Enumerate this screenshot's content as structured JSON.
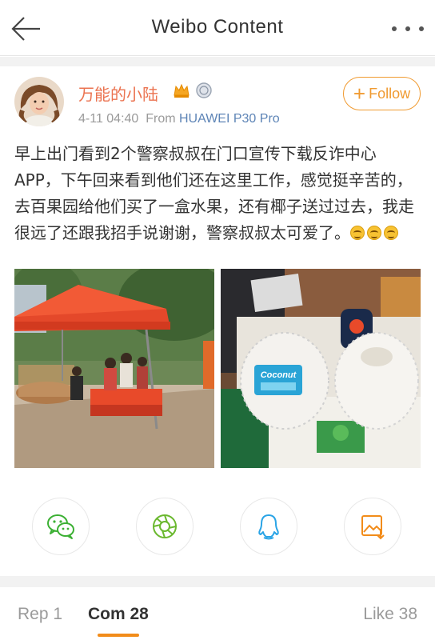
{
  "header": {
    "title": "Weibo Content"
  },
  "post": {
    "author": "万能的小陆",
    "time": "4-11 04:40",
    "from_label": "From",
    "device": "HUAWEI P30 Pro",
    "follow_label": "Follow",
    "text": "早上出门看到2个警察叔叔在门口宣传下载反诈中心APP，下午回来看到他们还在这里工作，感觉挺辛苦的，去百果园给他们买了一盒水果，还有椰子送过过去，我走很远了还跟我招手说谢谢，警察叔叔太可爱了。",
    "emoji_count": 3,
    "coconut_label": "Coconut"
  },
  "share": {
    "icons": [
      "wechat-icon",
      "moments-icon",
      "qq-icon",
      "save-image-icon"
    ]
  },
  "tabs": {
    "repost": "Rep 1",
    "comments": "Com 28",
    "likes": "Like 38"
  },
  "colors": {
    "accent": "#f28c1a",
    "author": "#eb7350",
    "device": "#5d84b6",
    "wechat": "#3cb034",
    "qq": "#2aa4e6"
  }
}
